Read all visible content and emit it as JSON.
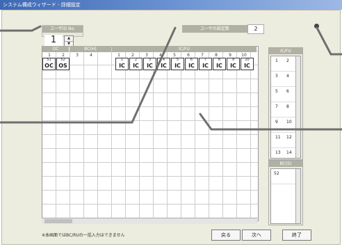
{
  "window": {
    "title": "システム構成ウィザード - 詳細設定"
  },
  "unit": {
    "label": "ユーザID No.",
    "value": "1"
  },
  "config": {
    "label": "ユーザの設定数",
    "value": "2"
  },
  "headers": {
    "oc": "OC",
    "bc": "BC(H)",
    "ic": "IC/FU"
  },
  "columns": [
    "1",
    "2",
    "3",
    "4",
    "1",
    "2",
    "3",
    "4",
    "5",
    "6",
    "7",
    "8",
    "9",
    "10"
  ],
  "cells": [
    {
      "n": "51",
      "l": "OC"
    },
    {
      "n": "52",
      "l": "OS"
    },
    {
      "n": "1",
      "l": "IC"
    },
    {
      "n": "2",
      "l": "IC"
    },
    {
      "n": "3",
      "l": "IC"
    },
    {
      "n": "4",
      "l": "IC"
    },
    {
      "n": "5",
      "l": "IC"
    },
    {
      "n": "6",
      "l": "IC"
    },
    {
      "n": "7",
      "l": "IC"
    },
    {
      "n": "8",
      "l": "IC"
    },
    {
      "n": "9",
      "l": "IC"
    },
    {
      "n": "10",
      "l": "IC"
    }
  ],
  "icfu_panel": {
    "label": "IC/FU",
    "rows": [
      [
        "1",
        "2"
      ],
      [
        "3",
        "4"
      ],
      [
        "5",
        "6"
      ],
      [
        "7",
        "8"
      ],
      [
        "9",
        "10"
      ],
      [
        "11",
        "12"
      ],
      [
        "13",
        "14"
      ]
    ]
  },
  "bc_panel": {
    "label": "BC(S)",
    "rows": [
      "52"
    ]
  },
  "footnote": "※本画面ではBC/RUの一括入力はできません",
  "buttons": {
    "back": "戻る",
    "next": "次へ",
    "finish": "終了"
  }
}
